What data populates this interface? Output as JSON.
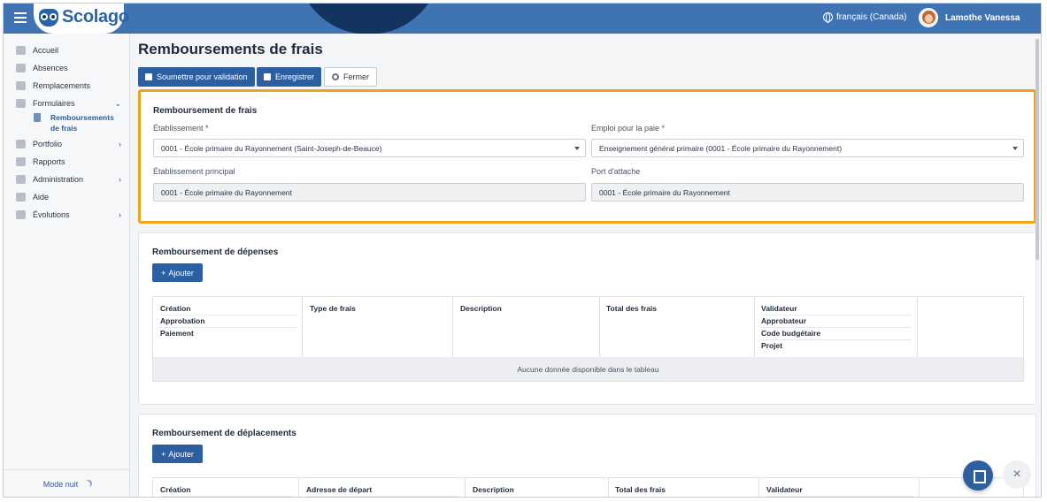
{
  "app": {
    "logo_text": "Scolago"
  },
  "header": {
    "language": "français (Canada)",
    "user_name": "Lamothe Vanessa"
  },
  "sidebar": {
    "items": [
      {
        "label": "Accueil"
      },
      {
        "label": "Absences"
      },
      {
        "label": "Remplacements"
      },
      {
        "label": "Formulaires"
      },
      {
        "label": "Portfolio"
      },
      {
        "label": "Rapports"
      },
      {
        "label": "Administration"
      },
      {
        "label": "Aide"
      },
      {
        "label": "Évolutions"
      }
    ],
    "sub_item": {
      "label_line1": "Remboursements",
      "label_line2": "de frais"
    },
    "mode_nuit": "Mode nuit"
  },
  "page": {
    "title": "Remboursements de frais",
    "toolbar": {
      "submit": "Soumettre pour validation",
      "save": "Enregistrer",
      "close": "Fermer"
    }
  },
  "section_frais": {
    "title": "Remboursement de frais",
    "etablissement_label": "Établissement *",
    "etablissement_value": "0001 - École primaire du Rayonnement (Saint-Joseph-de-Beauce)",
    "emploi_label": "Emploi pour la paie *",
    "emploi_value": "Enseignement général primaire (0001 - École primaire du Rayonnement)",
    "principal_label": "Établissement principal",
    "principal_value": "0001 - École primaire du Rayonnement",
    "port_label": "Port d'attache",
    "port_value": "0001 - École primaire du Rayonnement"
  },
  "section_depenses": {
    "title": "Remboursement de dépenses",
    "add": "Ajouter",
    "headers": {
      "creation": "Création",
      "approbation": "Approbation",
      "paiement": "Paiement",
      "type": "Type de frais",
      "description": "Description",
      "total": "Total des frais",
      "validateur": "Validateur",
      "approbateur": "Approbateur",
      "code": "Code budgétaire",
      "projet": "Projet"
    },
    "empty": "Aucune donnée disponible dans le tableau"
  },
  "section_deplacements": {
    "title": "Remboursement de déplacements",
    "add": "Ajouter",
    "headers": {
      "creation": "Création",
      "adresse": "Adresse de départ",
      "description": "Description",
      "total": "Total des frais",
      "validateur": "Validateur"
    }
  },
  "colors": {
    "primary": "#2d5fa0",
    "topbar": "#3f73b4",
    "highlight": "#f0a21d"
  }
}
